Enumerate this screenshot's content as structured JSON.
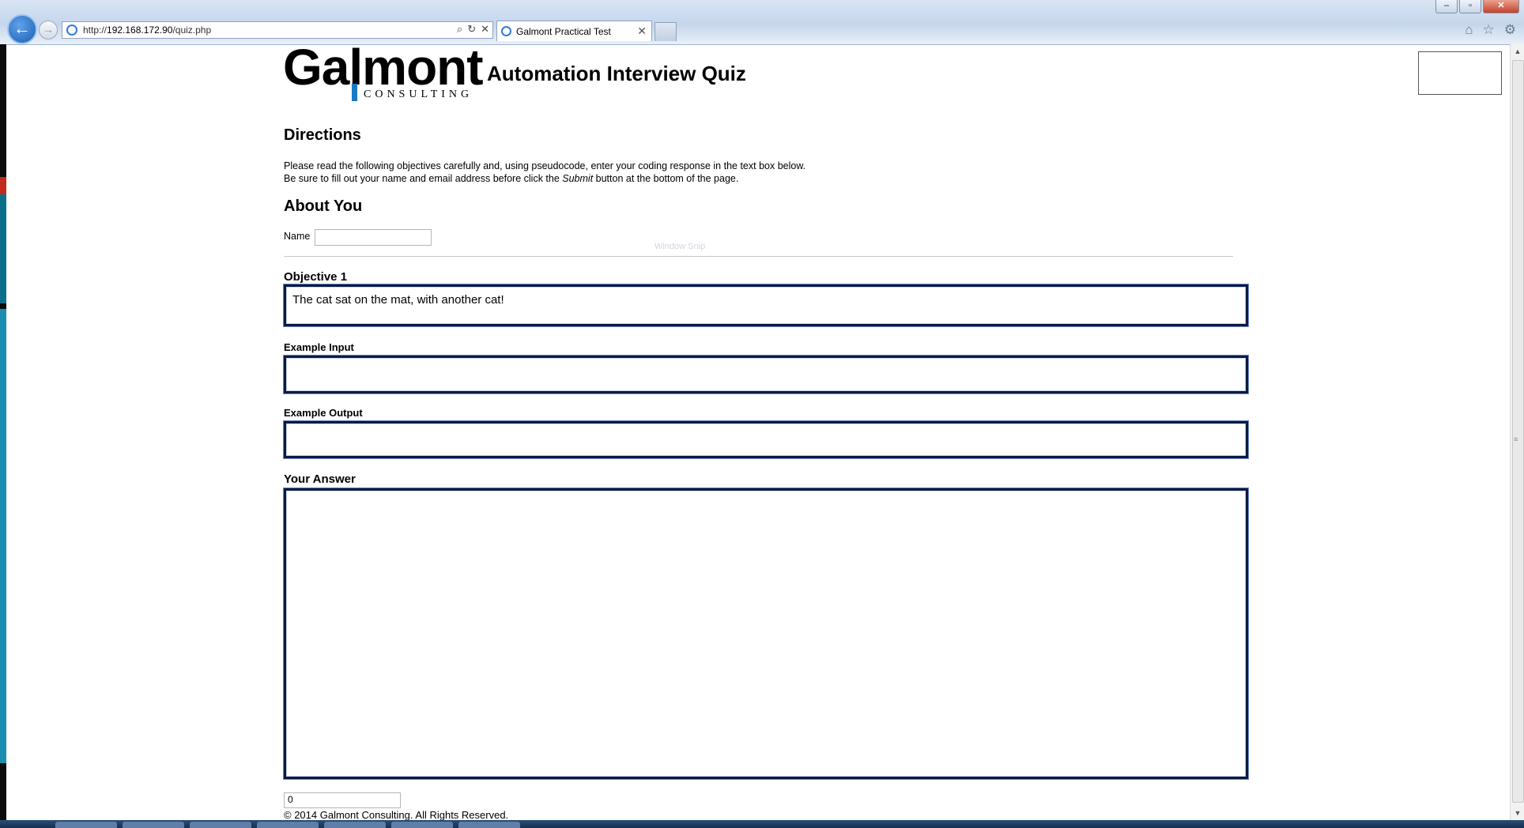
{
  "browser": {
    "url_prefix": "http://",
    "url_host": "192.168.172.90",
    "url_path": "/quiz.php",
    "tab_title": "Galmont Practical Test",
    "back_glyph": "←",
    "forward_glyph": "→",
    "close_tab_glyph": "✕",
    "search_glyph": "⌕",
    "refresh_glyph": "↻",
    "stop_glyph": "✕",
    "home_glyph": "⌂",
    "favorites_glyph": "☆",
    "settings_glyph": "⚙",
    "minimize_glyph": "–",
    "maximize_glyph": "▫",
    "close_window_glyph": "✕"
  },
  "header": {
    "logo_word": "Galmont",
    "logo_sub": "CONSULTING",
    "title": "Automation Interview Quiz"
  },
  "directions": {
    "heading": "Directions",
    "line1": "Please read the following objectives carefully and, using pseudocode, enter your coding response in the text box below.",
    "line2_before": "Be sure to fill out your name and email address before click the ",
    "line2_em": "Submit",
    "line2_after": " button at the bottom of the page."
  },
  "about": {
    "heading": "About You",
    "name_label": "Name",
    "name_value": ""
  },
  "overlay": {
    "snip_text": "Window Snip"
  },
  "objective": {
    "label": "Objective 1",
    "text": "The cat sat on the mat, with another cat!"
  },
  "example_input": {
    "label": "Example Input",
    "value": ""
  },
  "example_output": {
    "label": "Example Output",
    "value": ""
  },
  "answer": {
    "label": "Your Answer",
    "value": ""
  },
  "counter_value": "0",
  "footer": "© 2014 Galmont Consulting. All Rights Reserved.",
  "colors": {
    "logo_accent": "#1a79c4",
    "textbox_border": "#0b1a3e"
  }
}
